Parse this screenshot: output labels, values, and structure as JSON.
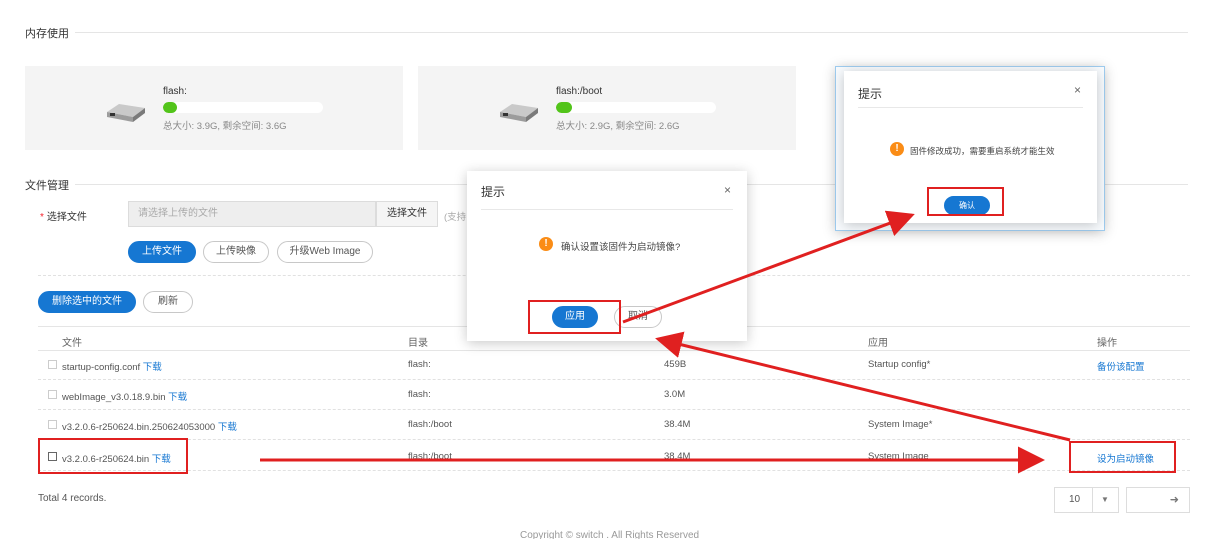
{
  "memory_section": {
    "title": "内存使用"
  },
  "storage": [
    {
      "name": "flash:",
      "used_fraction": 0.08,
      "info": "总大小: 3.9G, 剩余空间: 3.6G"
    },
    {
      "name": "flash:/boot",
      "used_fraction": 0.1,
      "info": "总大小: 2.9G, 剩余空间: 2.6G"
    }
  ],
  "file_section": {
    "title": "文件管理"
  },
  "upload_form": {
    "label": "选择文件",
    "placeholder": "请选择上传的文件",
    "choose_button": "选择文件",
    "hint": "(支持"
  },
  "actions": {
    "upload_file": "上传文件",
    "upload_image": "上传映像",
    "upgrade_web": "升级Web Image",
    "delete_selected": "删除选中的文件",
    "refresh": "刷新"
  },
  "table": {
    "headers": [
      "文件",
      "目录",
      "应用",
      "操作"
    ],
    "download_label": "下载",
    "rows": [
      {
        "file": "startup-config.conf",
        "dir": "flash:",
        "size": "459B",
        "app": "Startup config*",
        "op": "备份该配置"
      },
      {
        "file": "webImage_v3.0.18.9.bin",
        "dir": "flash:",
        "size": "3.0M",
        "app": "",
        "op": ""
      },
      {
        "file": "v3.2.0.6-r250624.bin.250624053000",
        "dir": "flash:/boot",
        "size": "38.4M",
        "app": "System Image*",
        "op": ""
      },
      {
        "file": "v3.2.0.6-r250624.bin",
        "dir": "flash:/boot",
        "size": "38.4M",
        "app": "System Image",
        "op": "设为启动镜像"
      }
    ]
  },
  "pagination": {
    "total": "Total 4 records.",
    "page_size": "10",
    "dropdown_icon": "caret-down-icon",
    "go_icon": "arrow-right-icon"
  },
  "footer": {
    "text": "Copyright © switch . All Rights Reserved"
  },
  "dialog_confirm": {
    "title": "提示",
    "close": "×",
    "message": "确认设置该固件为启动镜像?",
    "apply": "应用",
    "cancel": "取消"
  },
  "dialog_success": {
    "title": "提示",
    "close": "×",
    "message": "固件修改成功，需要重启系统才能生效",
    "confirm": "确认"
  },
  "colors": {
    "primary": "#1677d2",
    "annotation_red": "#e02020",
    "warning": "#fa8c16",
    "usage_green": "#52c41a"
  }
}
